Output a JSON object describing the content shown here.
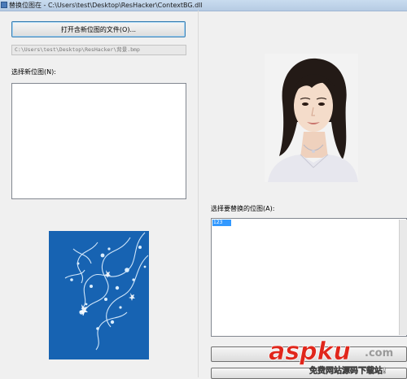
{
  "window": {
    "title": "替换位图在 - C:\\Users\\test\\Desktop\\ResHacker\\ContextBG.dll",
    "icon": "resource-hacker-icon"
  },
  "left_panel": {
    "open_button_label": "打开含新位图的文件(O)...",
    "file_path": "C:\\Users\\test\\Desktop\\ResHacker\\背景.bmp",
    "new_bitmap_label": "选择新位图(N):",
    "new_bitmap_list": [],
    "preview_colors": {
      "background": "#1763b2",
      "ornament": "#dbeefe"
    }
  },
  "right_panel": {
    "preview": "portrait photo of a woman",
    "replace_label": "选择要替换的位图(A):",
    "replace_list": [
      {
        "text": "123",
        "selected": true
      }
    ],
    "selection_color": "#3399ff"
  },
  "watermark": {
    "brand": "aspku",
    "tld": ".com",
    "tagline": "免费网站源码下载站!"
  }
}
